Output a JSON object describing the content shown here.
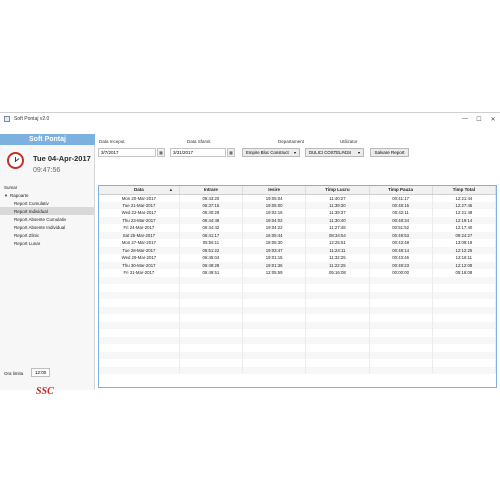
{
  "window": {
    "title": "Soft Pontaj v2.0",
    "minimize": "—",
    "maximize": "☐",
    "close": "✕"
  },
  "sidebar": {
    "brand": "Soft Pontaj",
    "date": "Tue 04-Apr-2017",
    "time": "09:47:56",
    "nav": [
      {
        "label": "Sumar",
        "level": 0
      },
      {
        "label": "Rapoarte",
        "level": 0,
        "expanded": true
      },
      {
        "label": "Report Cumulativ",
        "level": 1
      },
      {
        "label": "Report Individual",
        "level": 1,
        "selected": true
      },
      {
        "label": "Report Absente Cumulativ",
        "level": 1
      },
      {
        "label": "Report Absente Individual",
        "level": 1
      },
      {
        "label": "Report Zilnic",
        "level": 1
      },
      {
        "label": "Report Lunar",
        "level": 1
      }
    ],
    "ora_limita_label": "Ora limita",
    "ora_limita_value": "12:00",
    "logo": "SSC"
  },
  "filters": {
    "data_inceput_label": "Data Inceput",
    "data_inceput_value": "3/7/2017",
    "data_sfarsit_label": "Data Sfarsit",
    "data_sfarsit_value": "3/31/2017",
    "departament_label": "Departament",
    "departament_value": "Empire Bloc Construct",
    "utilizator_label": "Utilizator",
    "utilizator_value": "DULICI COSTEL#434",
    "save_label": "Salvare Report",
    "calendar_glyph": "▦",
    "dropdown_glyph": "▾"
  },
  "table": {
    "headers": [
      "Data",
      "Intrare",
      "Iesire",
      "Timp Lucru",
      "Timp Pauza",
      "Timp Total"
    ],
    "sort_glyph": "▲",
    "rows": [
      [
        "Mon 20-Mar-2017",
        "06:43:20",
        "19:05:04",
        "11:40:27",
        "00:41:17",
        "12:21:44"
      ],
      [
        "Tue 21-Mar-2017",
        "06:37:15",
        "19:05:00",
        "11:39:30",
        "00:48:15",
        "12:27:45"
      ],
      [
        "Wed 22-Mar-2017",
        "06:40:28",
        "19:02:16",
        "11:39:37",
        "00:42:11",
        "12:21:48"
      ],
      [
        "Thu 23-Mar-2017",
        "06:44:48",
        "19:04:02",
        "11:30:40",
        "00:48:34",
        "12:19:14"
      ],
      [
        "Fri 24-Mar-2017",
        "06:44:42",
        "19:04:22",
        "11:27:48",
        "00:51:52",
        "12:17:40"
      ],
      [
        "Sat 25-Mar-2017",
        "06:41:17",
        "16:05:44",
        "08:34:54",
        "00:49:53",
        "09:24:27"
      ],
      [
        "Mon 27-Mar-2017",
        "05:56:11",
        "18:05:30",
        "12:25:51",
        "00:43:48",
        "13:09:19"
      ],
      [
        "Tue 28-Mar-2017",
        "06:51:22",
        "19:03:47",
        "11:24:11",
        "00:48:14",
        "12:12:25"
      ],
      [
        "Wed 29-Mar-2017",
        "06:45:04",
        "19:01:15",
        "11:32:25",
        "00:43:46",
        "12:16:11"
      ],
      [
        "Thu 30-Mar-2017",
        "06:49:28",
        "19:01:36",
        "11:22:25",
        "00:49:23",
        "12:12:08"
      ],
      [
        "Fri 31-Mar-2017",
        "06:49:51",
        "12:05:59",
        "05:16:08",
        "00:00:00",
        "05:16:08"
      ]
    ]
  }
}
